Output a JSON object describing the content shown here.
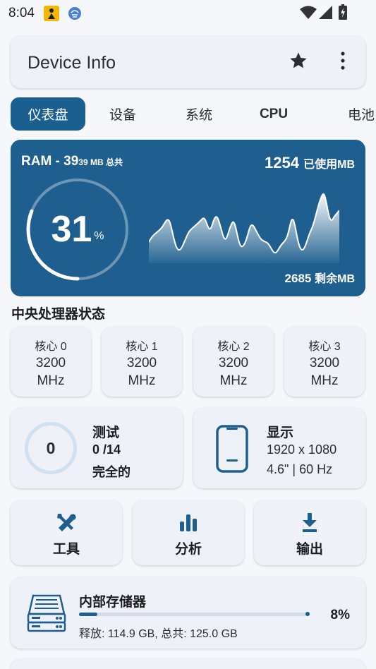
{
  "status": {
    "time": "8:04"
  },
  "appbar": {
    "title": "Device Info",
    "icons": [
      "star-icon",
      "more-vert-icon"
    ]
  },
  "tabs": [
    {
      "label": "仪表盘",
      "active": true
    },
    {
      "label": "设备",
      "active": false
    },
    {
      "label": "系统",
      "active": false
    },
    {
      "label": "CPU",
      "active": false
    },
    {
      "label": "电池",
      "active": false
    }
  ],
  "ram": {
    "title_prefix": "RAM - 39",
    "title_suffix": "39 MB 总共",
    "used_value": "1254",
    "used_label": "已使用MB",
    "free_value": "2685",
    "free_label": "剩余MB",
    "percent": 31,
    "percent_text": "31",
    "percent_sign": "%"
  },
  "cpu": {
    "title": "中央处理器状态",
    "cores": [
      {
        "name": "核心 0",
        "value": "3200",
        "unit": "MHz"
      },
      {
        "name": "核心 1",
        "value": "3200",
        "unit": "MHz"
      },
      {
        "name": "核心 2",
        "value": "3200",
        "unit": "MHz"
      },
      {
        "name": "核心 3",
        "value": "3200",
        "unit": "MHz"
      }
    ]
  },
  "test": {
    "count": "0",
    "title": "测试",
    "progress": "0 /14",
    "status": "完全的"
  },
  "display": {
    "title": "显示",
    "resolution": "1920 x 1080",
    "details": "4.6\" | 60 Hz"
  },
  "actions": [
    {
      "label": "工具",
      "icon": "tools-icon"
    },
    {
      "label": "分析",
      "icon": "bar-chart-icon"
    },
    {
      "label": "输出",
      "icon": "download-icon"
    }
  ],
  "storage": {
    "title": "内部存储器",
    "percent": 8,
    "percent_text": "8%",
    "free_label": "释放: 114.9 GB,  总共: 125.0 GB"
  },
  "colors": {
    "primary": "#1e5f8f",
    "card": "#eef1f8",
    "background": "#f5f7fb"
  }
}
